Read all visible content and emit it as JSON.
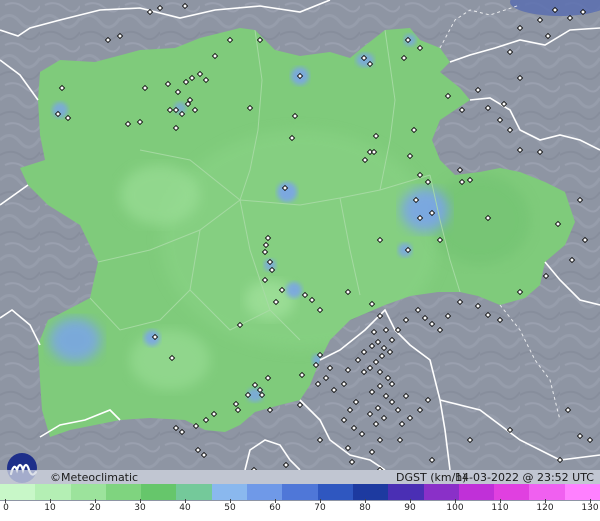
{
  "brand": "©Meteoclimatic",
  "variable": "DGST (km/h)",
  "timestamp": "14-03-2022 @ 23:52 UTC",
  "legend": {
    "ticks": [
      "0",
      "10",
      "20",
      "30",
      "40",
      "50",
      "60",
      "70",
      "80",
      "90",
      "100",
      "110",
      "120",
      "130"
    ],
    "colors": [
      "#c8f7c8",
      "#b4efb4",
      "#9ce39c",
      "#7fd47f",
      "#66c66b",
      "#74c99a",
      "#8ab8ee",
      "#6f99e8",
      "#4f77d8",
      "#2f57c0",
      "#1d3aa0",
      "#4a2fb4",
      "#8a30c8",
      "#c030d8",
      "#e040e0",
      "#f060f0",
      "#ff80ff"
    ]
  },
  "colors": {
    "land_surround": "#8e95a4",
    "region_fill": "#7fcb7b",
    "gust_blue": "#7aa4ea",
    "station_dot": "#111111",
    "border_white": "#ffffff"
  },
  "icons": {
    "logo": "meteoclimatic-m-logo"
  }
}
